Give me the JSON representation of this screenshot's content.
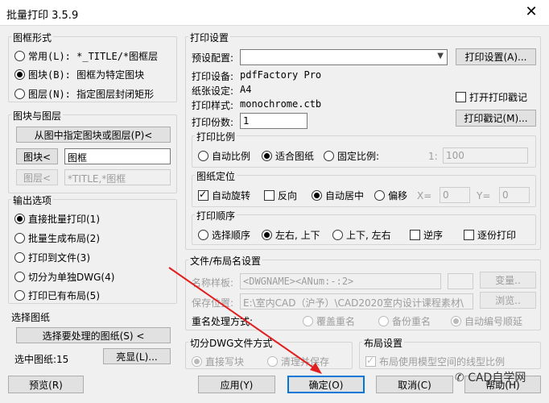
{
  "window": {
    "title": "批量打印 3.5.9",
    "close_glyph": "✕"
  },
  "frame_form": {
    "label": "图框形式",
    "options": [
      {
        "text": "常用(L): *_TITLE/*图框层",
        "selected": false
      },
      {
        "text": "图块(B): 图框为特定图块",
        "selected": true
      },
      {
        "text": "图层(N): 指定图层封闭矩形",
        "selected": false
      }
    ]
  },
  "block_layer": {
    "label": "图块与图层",
    "pick_button": "从图中指定图块或图层(P)<",
    "block_button": "图块<",
    "block_value": "图框",
    "layer_button": "图层<",
    "layer_value": "*TITLE,*图框"
  },
  "output": {
    "label": "输出选项",
    "options": [
      {
        "text": "直接批量打印(1)",
        "selected": true
      },
      {
        "text": "批量生成布局(2)",
        "selected": false
      },
      {
        "text": "打印到文件(3)",
        "selected": false
      },
      {
        "text": "切分为单独DWG(4)",
        "selected": false
      },
      {
        "text": "打印已有布局(5)",
        "selected": false
      }
    ]
  },
  "select": {
    "label": "选择图纸",
    "button": "选择要处理的图纸(S) <",
    "count_label": "选中图纸:15",
    "highlight_button": "亮显(L)..."
  },
  "print_settings": {
    "label": "打印设置",
    "preset_label": "预设配置:",
    "preset_value": "",
    "settings_button": "打印设置(A)...",
    "device_label": "打印设备:",
    "device_value": "pdfFactory Pro",
    "paper_label": "纸张设定:",
    "paper_value": "A4",
    "style_label": "打印样式:",
    "style_value": "monochrome.ctb",
    "stamp_check": "打开打印戳记",
    "stamp_checked": false,
    "copies_label": "打印份数:",
    "copies_value": "1",
    "stamp_button": "打印戳记(M)..."
  },
  "scale": {
    "label": "打印比例",
    "options": [
      {
        "text": "自动比例",
        "selected": false
      },
      {
        "text": "适合图纸",
        "selected": true
      },
      {
        "text": "固定比例:",
        "selected": false
      }
    ],
    "ratio_prefix": "1:",
    "ratio_value": "100"
  },
  "position": {
    "label": "图纸定位",
    "auto_rotate": "自动旋转",
    "auto_rotate_checked": true,
    "reverse": "反向",
    "reverse_checked": false,
    "center": "自动居中",
    "center_selected": true,
    "offset": "偏移",
    "offset_selected": false,
    "x_label": "X=",
    "x_value": "0",
    "y_label": "Y=",
    "y_value": "0"
  },
  "order": {
    "label": "打印顺序",
    "options": [
      {
        "text": "选择顺序",
        "selected": false
      },
      {
        "text": "左右, 上下",
        "selected": true
      },
      {
        "text": "上下, 左右",
        "selected": false
      }
    ],
    "reverse": "逆序",
    "reverse_checked": false,
    "page_by_page": "逐份打印",
    "page_by_page_checked": false
  },
  "file_naming": {
    "label": "文件/布局名设置",
    "template_label": "名称样板:",
    "template_value": "<DWGNAME><ANum:-:2>",
    "variable_button": "变量..",
    "save_label": "保存位置:",
    "save_value": "E:\\室内CAD（沪予）\\CAD2020室内设计课程素材\\",
    "browse_button": "浏览..",
    "dup_label": "重名处理方式:",
    "dup_options": [
      {
        "text": "覆盖重名",
        "selected": false
      },
      {
        "text": "备份重名",
        "selected": false
      },
      {
        "text": "自动编号顺延",
        "selected": true
      }
    ]
  },
  "split": {
    "label": "切分DWG文件方式",
    "options": [
      {
        "text": "直接写块",
        "selected": true
      },
      {
        "text": "清理并保存",
        "selected": false
      }
    ]
  },
  "layout": {
    "label": "布局设置",
    "check": "布局使用模型空间的线型比例",
    "checked": true
  },
  "footer": {
    "preview": "预览(R)",
    "apply": "应用(Y)",
    "ok": "确定(O)",
    "cancel": "取消(C)",
    "help": "帮助(H)"
  },
  "watermark": {
    "text": "CAD自学网"
  }
}
